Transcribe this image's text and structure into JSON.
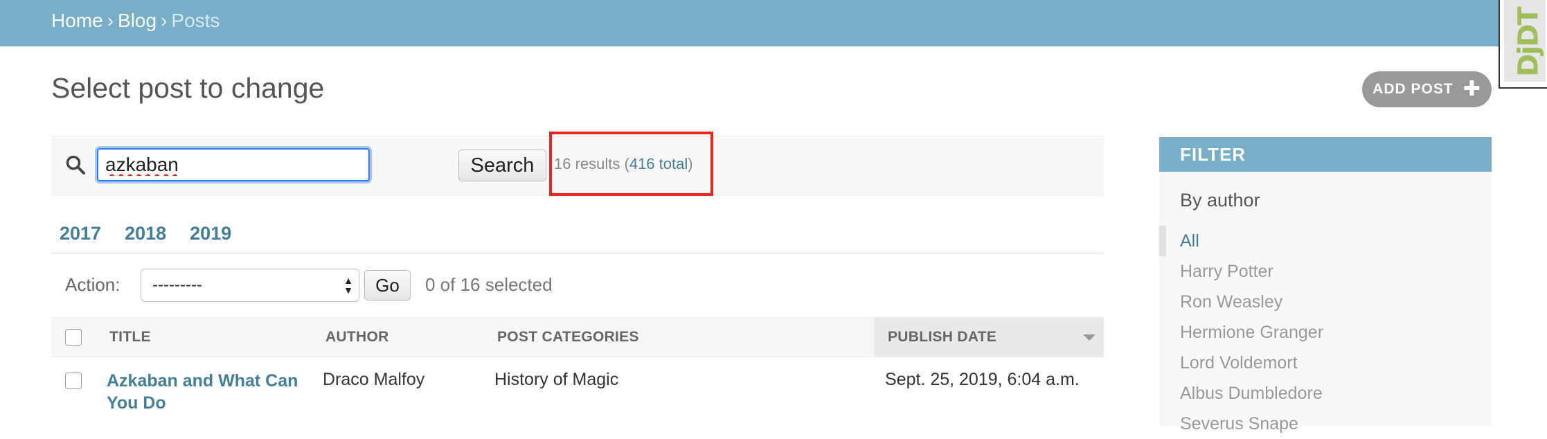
{
  "breadcrumbs": {
    "home": "Home",
    "sep1": "›",
    "blog": "Blog",
    "sep2": "›",
    "current": "Posts"
  },
  "debug_toolbar": {
    "label": "DjDT"
  },
  "page_title": "Select post to change",
  "add_button": {
    "label": "ADD POST",
    "icon": "plus-icon"
  },
  "search": {
    "value": "azkaban",
    "button_label": "Search",
    "icon": "search-icon"
  },
  "results": {
    "prefix": "16 results (",
    "total_link": "416 total",
    "suffix": ")"
  },
  "date_hierarchy": [
    "2017",
    "2018",
    "2019"
  ],
  "actions": {
    "label": "Action:",
    "selected_option": "---------",
    "go_label": "Go",
    "selected_count": "0 of 16 selected"
  },
  "table": {
    "columns": [
      "TITLE",
      "AUTHOR",
      "POST CATEGORIES",
      "PUBLISH DATE"
    ],
    "rows": [
      {
        "title": "Azkaban and What Can You Do",
        "author": "Draco Malfoy",
        "categories": "History of Magic",
        "publish_date": "Sept. 25, 2019, 6:04 a.m."
      }
    ]
  },
  "filter": {
    "header": "FILTER",
    "subheading": "By author",
    "options": [
      "All",
      "Harry Potter",
      "Ron Weasley",
      "Hermione Granger",
      "Lord Voldemort",
      "Albus Dumbledore",
      "Severus Snape"
    ],
    "selected": "All"
  },
  "colors": {
    "header_blue": "#79aec8",
    "link_blue": "#447e9b",
    "highlight_red": "#e8281f"
  }
}
